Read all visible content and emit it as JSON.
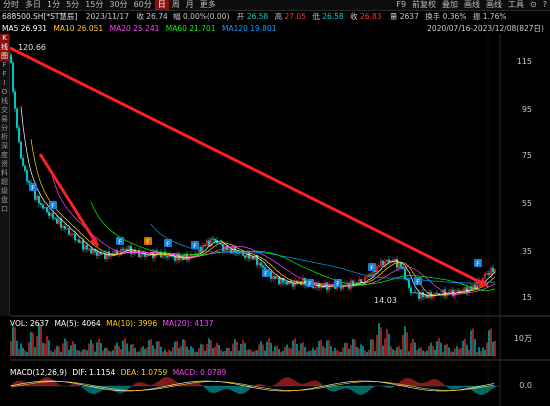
{
  "toolbar": {
    "periods": [
      "分时",
      "多日",
      "1分",
      "5分",
      "15分",
      "30分",
      "60分",
      "日",
      "周",
      "月",
      "更多"
    ],
    "active_period": "日",
    "right_items": [
      "F9",
      "前复权",
      "叠加",
      "画线",
      "画线",
      "工具",
      "⊙",
      "?"
    ]
  },
  "quote": {
    "code": "688500.SH[*ST慧辰]",
    "date": "2023/11/17",
    "close_label": "收",
    "close": "26.74",
    "change": "幅 0.00%(0.00)",
    "open_label": "开",
    "open": "26.58",
    "high_label": "高",
    "high": "27.05",
    "low_label": "低",
    "low": "26.58",
    "cur_label": "收",
    "cur": "26.83",
    "vol_label": "量",
    "vol": "2637",
    "turnover_label": "换手",
    "turnover": "0.36%",
    "amp_label": "振",
    "amp": "1.76%"
  },
  "ma": {
    "ma5_label": "MA5",
    "ma5": "26.931",
    "ma10_label": "MA10",
    "ma10": "26.051",
    "ma20_label": "MA20",
    "ma20": "25.241",
    "ma60_label": "MA60",
    "ma60": "21.701",
    "ma120_label": "MA120",
    "ma120": "19.801"
  },
  "date_range": "2020/07/16-2023/12/08(827日)",
  "sidebar": [
    "K线",
    "图",
    "F",
    "F",
    "I",
    "O",
    "线",
    "交",
    "易",
    "分",
    "析",
    "深",
    "度",
    "资",
    "料",
    "超",
    "级",
    "盘",
    "口"
  ],
  "price_axis": [
    "115",
    "95",
    "75",
    "55",
    "35",
    "15"
  ],
  "annotations": {
    "high": "120.66",
    "low": "14.03"
  },
  "vol_panel": {
    "label": "VOL: 2637",
    "ma5": "MA(5): 4064",
    "ma10": "MA(10): 3996",
    "ma20": "MA(20): 4137",
    "axis": "10万"
  },
  "macd_panel": {
    "label": "MACD(12,26,9)",
    "dif": "DIF: 1.1154",
    "dea": "DEA: 1.0759",
    "macd": "MACD: 0.0789",
    "axis": "0.0"
  },
  "colors": {
    "up": "#ff3333",
    "down": "#00d0d0",
    "ma5": "#ffffff",
    "ma10": "#ffd000",
    "ma20": "#ff40ff",
    "ma60": "#00ff00",
    "ma120": "#00a0ff",
    "arrow": "#ff2020"
  },
  "icons": [
    "settings-icon",
    "help-icon"
  ]
}
